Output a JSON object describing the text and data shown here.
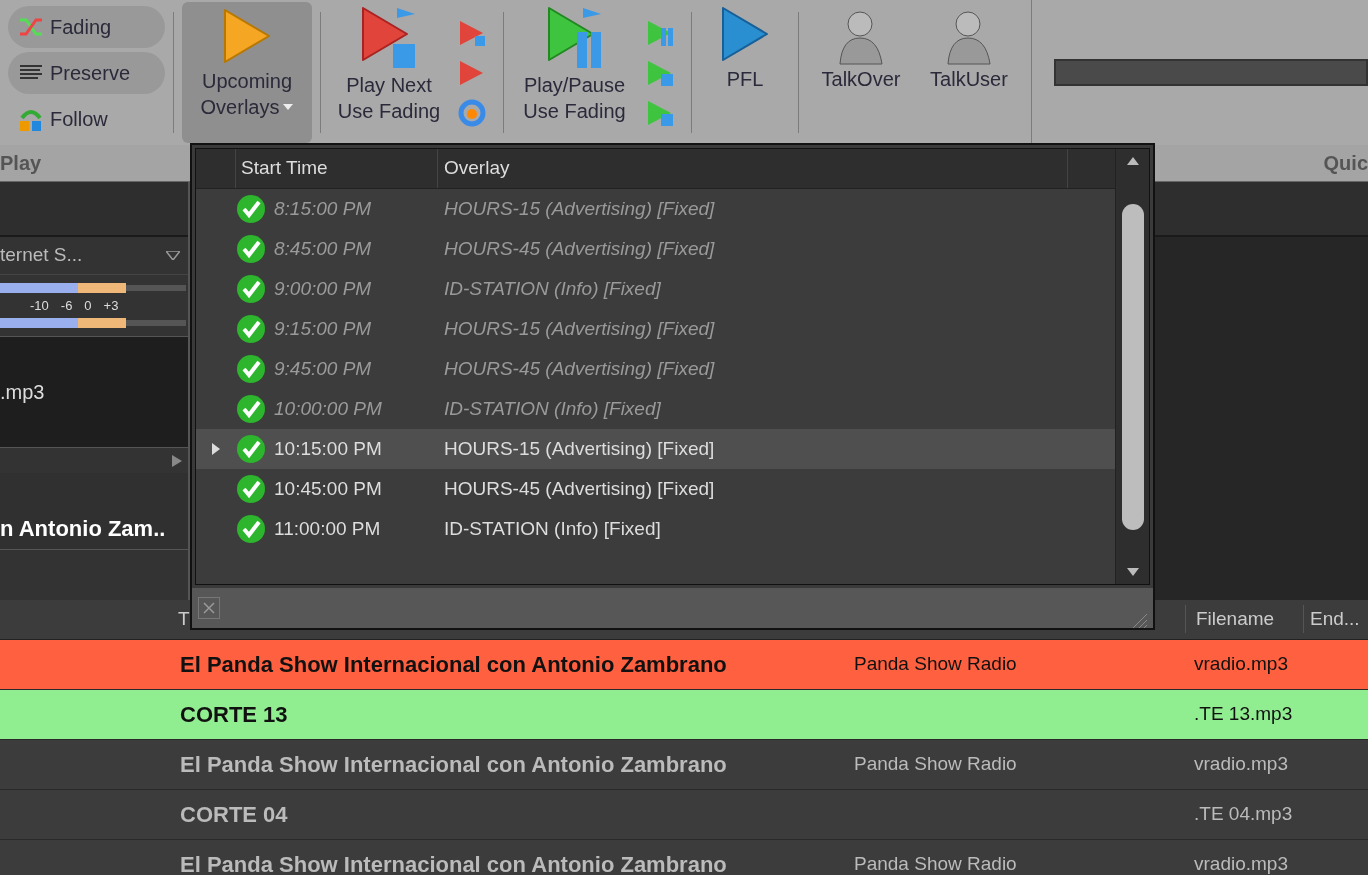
{
  "ribbon": {
    "toggles": [
      {
        "label": "Fading",
        "checked": true,
        "kind": "fading"
      },
      {
        "label": "Preserve",
        "checked": true,
        "kind": "preserve"
      },
      {
        "label": "Follow",
        "checked": false,
        "kind": "follow"
      }
    ],
    "upcoming_overlays": {
      "label_1": "Upcoming",
      "label_2": "Overlays",
      "pressed": true
    },
    "play_next": {
      "label_1": "Play Next",
      "label_2": "Use Fading"
    },
    "play_pause": {
      "label_1": "Play/Pause",
      "label_2": "Use Fading"
    },
    "pfl": {
      "label": "PFL"
    },
    "talk_buttons": [
      {
        "label": "TalkOver"
      },
      {
        "label": "TalkUser"
      }
    ],
    "progress": {
      "level": 0
    },
    "group_labels": [
      "Play",
      "Quic"
    ]
  },
  "left_panel": {
    "output_name": "ternet S...",
    "meter_scale": [
      "-10",
      "-6",
      "0",
      "+3"
    ],
    "file": ".mp3",
    "title": "n Antonio Zam.."
  },
  "overlays_popup": {
    "columns": [
      "Start Time",
      "Overlay"
    ],
    "rows": [
      {
        "start_time": "8:15:00 PM",
        "overlay": "HOURS-15 (Advertising) [Fixed]",
        "past": true,
        "selected": false
      },
      {
        "start_time": "8:45:00 PM",
        "overlay": "HOURS-45 (Advertising) [Fixed]",
        "past": true,
        "selected": false
      },
      {
        "start_time": "9:00:00 PM",
        "overlay": "ID-STATION (Info) [Fixed]",
        "past": true,
        "selected": false
      },
      {
        "start_time": "9:15:00 PM",
        "overlay": "HOURS-15 (Advertising) [Fixed]",
        "past": true,
        "selected": false
      },
      {
        "start_time": "9:45:00 PM",
        "overlay": "HOURS-45 (Advertising) [Fixed]",
        "past": true,
        "selected": false
      },
      {
        "start_time": "10:00:00 PM",
        "overlay": "ID-STATION (Info) [Fixed]",
        "past": true,
        "selected": false
      },
      {
        "start_time": "10:15:00 PM",
        "overlay": "HOURS-15 (Advertising) [Fixed]",
        "past": false,
        "selected": true
      },
      {
        "start_time": "10:45:00 PM",
        "overlay": "HOURS-45 (Advertising) [Fixed]",
        "past": false,
        "selected": false
      },
      {
        "start_time": "11:00:00 PM",
        "overlay": "ID-STATION (Info) [Fixed]",
        "past": false,
        "selected": false
      }
    ]
  },
  "playlist": {
    "columns": {
      "column_1": "T",
      "filename": "Filename",
      "column_4": "End..."
    },
    "rows": [
      {
        "title": "El Panda Show Internacional con Antonio Zambrano",
        "artist": "Panda Show Radio",
        "filename": "vradio.mp3",
        "color": "#ff6040"
      },
      {
        "title": "CORTE 13",
        "filename": ".TE 13.mp3",
        "color": "#90ee90"
      },
      {
        "title": "El Panda Show Internacional con Antonio Zambrano",
        "artist": "Panda Show Radio",
        "filename": "vradio.mp3"
      },
      {
        "title": "CORTE 04",
        "filename": ".TE 04.mp3"
      },
      {
        "title": "El Panda Show Internacional con Antonio Zambrano",
        "artist": "Panda Show Radio",
        "filename": "vradio.mp3"
      }
    ]
  }
}
